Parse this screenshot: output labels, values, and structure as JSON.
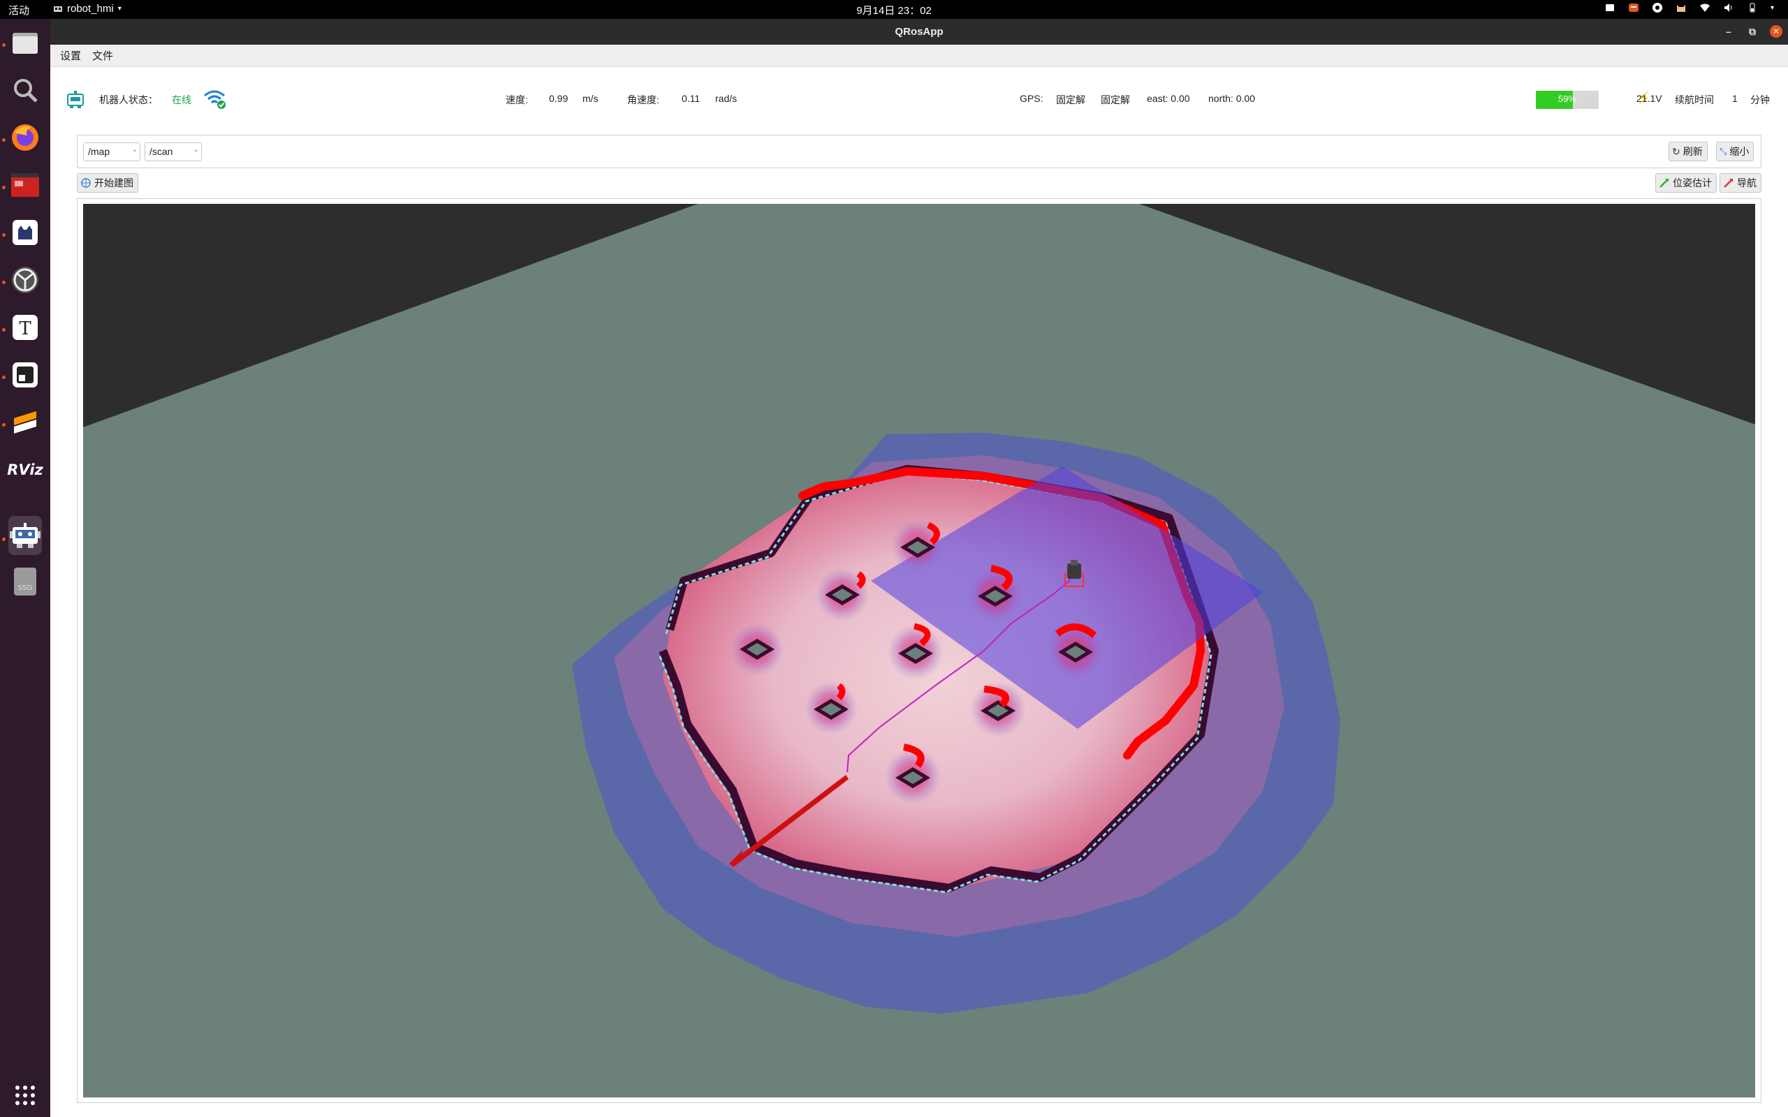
{
  "topbar": {
    "activities": "活动",
    "app_name": "robot_hmi",
    "clock": "9月14日  23：02"
  },
  "dock": {
    "items": [
      "files-icon",
      "search-icon",
      "firefox-icon",
      "terminal-icon",
      "qtcreator-icon",
      "robot-network-icon",
      "text-editor-icon",
      "app-icon",
      "sublime-icon",
      "rviz-icon",
      "qrosapp-icon",
      "ssd-drive-icon"
    ],
    "rviz_label": "RViz",
    "ssd_label": "SSD"
  },
  "window": {
    "title": "QRosApp"
  },
  "menubar": {
    "settings": "设置",
    "file": "文件"
  },
  "status": {
    "robot_state_label": "机器人状态：",
    "robot_state_value": "在线",
    "speed_label": "速度:",
    "speed_value": "0.99",
    "speed_unit": "m/s",
    "angular_label": "角速度:",
    "angular_value": "0.11",
    "angular_unit": "rad/s",
    "gps_label": "GPS:",
    "gps_fix1": "固定解",
    "gps_fix2": "固定解",
    "east": "east: 0.00",
    "north": "north: 0.00",
    "battery_percent_text": "59%",
    "battery_level": 0.59,
    "voltage": "21.1V",
    "endurance_label": "续航时间",
    "endurance_value": "1",
    "endurance_unit": "分钟"
  },
  "topics": {
    "map_topic": "/map",
    "scan_topic": "/scan",
    "refresh": "刷新",
    "shrink": "缩小"
  },
  "toolbar": {
    "start_mapping": "开始建图",
    "pose_estimate": "位姿估计",
    "navigate": "导航"
  },
  "colors": {
    "accent_orange": "#e95420",
    "online_green": "#1aa44a",
    "battery_green": "#33cc22",
    "ground": "#6b817a",
    "laser_red": "#ff0000"
  }
}
